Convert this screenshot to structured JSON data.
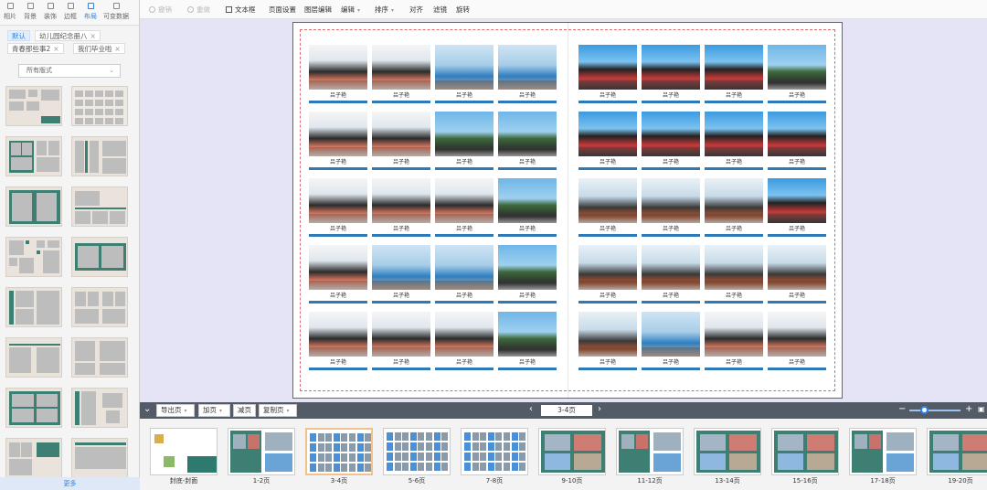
{
  "left_panel": {
    "tabs": [
      {
        "label": "相片",
        "icon": "photo-icon"
      },
      {
        "label": "背景",
        "icon": "background-icon"
      },
      {
        "label": "装饰",
        "icon": "decoration-icon"
      },
      {
        "label": "边框",
        "icon": "border-icon"
      },
      {
        "label": "布局",
        "icon": "layout-icon",
        "active": true
      },
      {
        "label": "可变数据",
        "icon": "variable-data-icon"
      }
    ],
    "template_tags": [
      "默认",
      "幼儿园纪念册八",
      "青春那些事2",
      "我们毕业啦"
    ],
    "format_select": "所有版式",
    "more_label": "更多"
  },
  "toolbar": {
    "undo": "撤销",
    "redo": "重做",
    "text_box": "文本框",
    "page_setup": "页面设置",
    "layer_edit": "图层编辑",
    "edit": "编辑",
    "sort": "排序",
    "align": "对齐",
    "filter": "滤镜",
    "rotate": "旋转"
  },
  "canvas": {
    "caption": "吕子艳",
    "accent_color": "#2e7ab8",
    "bleed_color": "#e06d6d"
  },
  "page_bar": {
    "export": "导出页",
    "add_page": "加页",
    "remove_page": "减页",
    "copy_page": "复制页",
    "current_page": "3-4页"
  },
  "thumbnails": [
    "封底-封面",
    "1-2页",
    "3-4页",
    "5-6页",
    "7-8页",
    "9-10页",
    "11-12页",
    "13-14页",
    "15-16页",
    "17-18页",
    "19-20页"
  ],
  "selected_thumbnail": "3-4页"
}
